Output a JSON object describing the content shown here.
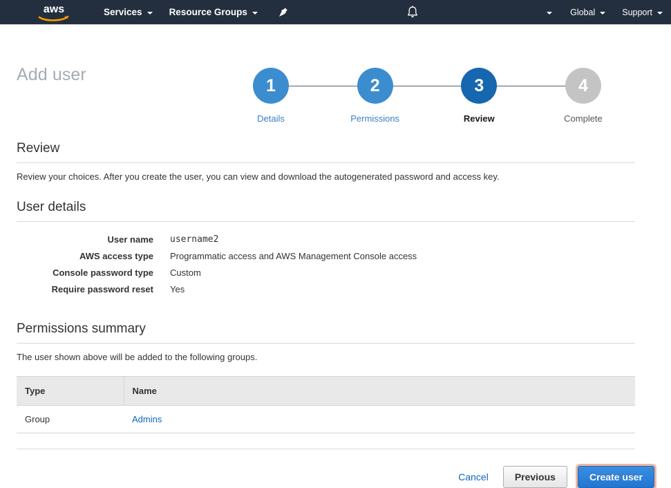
{
  "nav": {
    "logo_alt": "aws",
    "services": "Services",
    "resource_groups": "Resource Groups",
    "pin_icon": "pin-icon",
    "bell_icon": "bell-icon",
    "account_label": "",
    "global": "Global",
    "support": "Support"
  },
  "page": {
    "title": "Add user"
  },
  "stepper": {
    "steps": [
      {
        "number": "1",
        "label": "Details",
        "state": "done"
      },
      {
        "number": "2",
        "label": "Permissions",
        "state": "done"
      },
      {
        "number": "3",
        "label": "Review",
        "state": "current"
      },
      {
        "number": "4",
        "label": "Complete",
        "state": "todo"
      }
    ]
  },
  "review": {
    "heading": "Review",
    "description": "Review your choices. After you create the user, you can view and download the autogenerated password and access key."
  },
  "user_details": {
    "heading": "User details",
    "rows": [
      {
        "label": "User name",
        "value": "username2",
        "mono": true
      },
      {
        "label": "AWS access type",
        "value": "Programmatic access and AWS Management Console access",
        "mono": false
      },
      {
        "label": "Console password type",
        "value": "Custom",
        "mono": false
      },
      {
        "label": "Require password reset",
        "value": "Yes",
        "mono": false
      }
    ]
  },
  "permissions_summary": {
    "heading": "Permissions summary",
    "description": "The user shown above will be added to the following groups.",
    "columns": [
      "Type",
      "Name"
    ],
    "rows": [
      {
        "type": "Group",
        "name": "Admins"
      }
    ]
  },
  "footer": {
    "cancel": "Cancel",
    "previous": "Previous",
    "create": "Create user"
  },
  "colors": {
    "nav_bg": "#232f3e",
    "accent_orange": "#ff9900",
    "step_done": "#3c8dd0",
    "step_current": "#1666b0",
    "step_todo": "#c4c4c4",
    "link": "#1166bb",
    "primary_button": "#2176d2",
    "title_gray": "#a4acb4"
  }
}
